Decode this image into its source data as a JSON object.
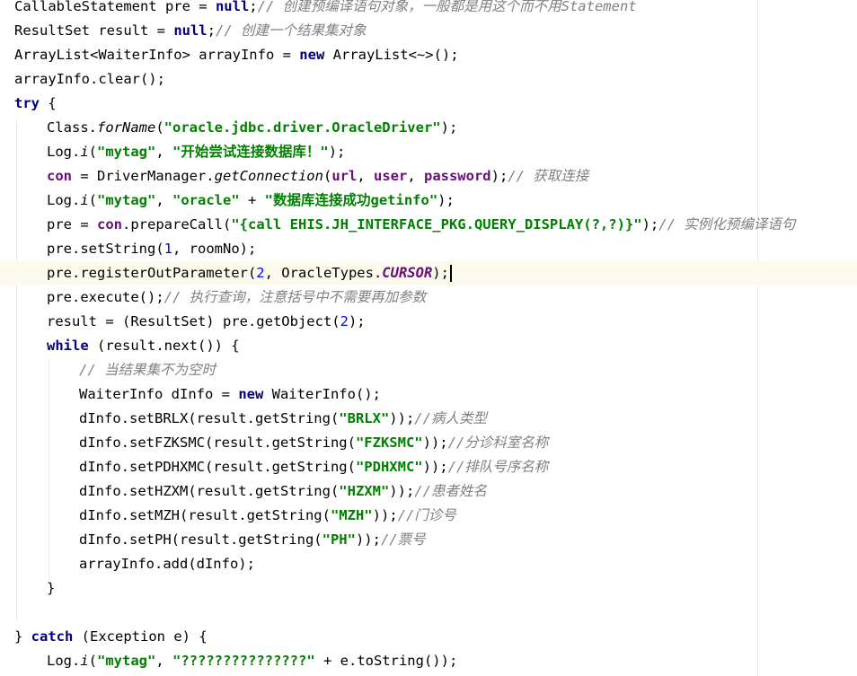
{
  "editor": {
    "caret_line": 11,
    "colors": {
      "keyword": "#000080",
      "string": "#008000",
      "comment": "#808080",
      "field": "#660e7a",
      "number": "#0000ff",
      "current_line": "#fcfaed"
    },
    "lines": [
      {
        "indent": 0,
        "tokens": [
          [
            "p",
            "CallableStatement pre = "
          ],
          [
            "k",
            "null"
          ],
          [
            "p",
            ";"
          ],
          [
            "c",
            "// 创建预编译语句对象，一般都是用这个而不用Statement"
          ]
        ]
      },
      {
        "indent": 0,
        "tokens": [
          [
            "p",
            "ResultSet result = "
          ],
          [
            "k",
            "null"
          ],
          [
            "p",
            ";"
          ],
          [
            "c",
            "// 创建一个结果集对象"
          ]
        ]
      },
      {
        "indent": 0,
        "tokens": [
          [
            "p",
            "ArrayList<WaiterInfo> arrayInfo = "
          ],
          [
            "k",
            "new"
          ],
          [
            "p",
            " ArrayList<~>();"
          ]
        ]
      },
      {
        "indent": 0,
        "tokens": [
          [
            "p",
            "arrayInfo.clear();"
          ]
        ]
      },
      {
        "indent": 0,
        "tokens": [
          [
            "k",
            "try"
          ],
          [
            "p",
            " {"
          ]
        ]
      },
      {
        "indent": 1,
        "tokens": [
          [
            "p",
            "Class."
          ],
          [
            "i",
            "forName"
          ],
          [
            "p",
            "("
          ],
          [
            "s",
            "\"oracle.jdbc.driver.OracleDriver\""
          ],
          [
            "p",
            ");"
          ]
        ]
      },
      {
        "indent": 1,
        "tokens": [
          [
            "p",
            "Log."
          ],
          [
            "i",
            "i"
          ],
          [
            "p",
            "("
          ],
          [
            "s",
            "\"mytag\""
          ],
          [
            "p",
            ", "
          ],
          [
            "s",
            "\"开始尝试连接数据库！\""
          ],
          [
            "p",
            ");"
          ]
        ]
      },
      {
        "indent": 1,
        "tokens": [
          [
            "f",
            "con"
          ],
          [
            "p",
            " = DriverManager."
          ],
          [
            "i",
            "getConnection"
          ],
          [
            "p",
            "("
          ],
          [
            "f",
            "url"
          ],
          [
            "p",
            ", "
          ],
          [
            "f",
            "user"
          ],
          [
            "p",
            ", "
          ],
          [
            "f",
            "password"
          ],
          [
            "p",
            ");"
          ],
          [
            "c",
            "// 获取连接"
          ]
        ]
      },
      {
        "indent": 1,
        "tokens": [
          [
            "p",
            "Log."
          ],
          [
            "i",
            "i"
          ],
          [
            "p",
            "("
          ],
          [
            "s",
            "\"mytag\""
          ],
          [
            "p",
            ", "
          ],
          [
            "s",
            "\"oracle\""
          ],
          [
            "p",
            " + "
          ],
          [
            "s",
            "\"数据库连接成功getinfo\""
          ],
          [
            "p",
            ");"
          ]
        ]
      },
      {
        "indent": 1,
        "tokens": [
          [
            "p",
            "pre = "
          ],
          [
            "f",
            "con"
          ],
          [
            "p",
            ".prepareCall("
          ],
          [
            "s",
            "\"{call EHIS.JH_INTERFACE_PKG.QUERY_DISPLAY(?,?)}\""
          ],
          [
            "p",
            ");"
          ],
          [
            "c",
            "// 实例化预编译语句"
          ]
        ]
      },
      {
        "indent": 1,
        "tokens": [
          [
            "p",
            "pre.setString("
          ],
          [
            "n",
            "1"
          ],
          [
            "p",
            ", roomNo);"
          ]
        ]
      },
      {
        "indent": 1,
        "tokens": [
          [
            "p",
            "pre.registerOutParameter("
          ],
          [
            "n",
            "2"
          ],
          [
            "p",
            ", OracleTypes."
          ],
          [
            "x",
            "CURSOR"
          ],
          [
            "p",
            ");"
          ]
        ]
      },
      {
        "indent": 1,
        "tokens": [
          [
            "p",
            "pre.execute();"
          ],
          [
            "c",
            "// 执行查询，注意括号中不需要再加参数"
          ]
        ]
      },
      {
        "indent": 1,
        "tokens": [
          [
            "p",
            "result = (ResultSet) pre.getObject("
          ],
          [
            "n",
            "2"
          ],
          [
            "p",
            ");"
          ]
        ]
      },
      {
        "indent": 1,
        "tokens": [
          [
            "k",
            "while"
          ],
          [
            "p",
            " (result.next()) {"
          ]
        ]
      },
      {
        "indent": 2,
        "tokens": [
          [
            "c",
            "// 当结果集不为空时"
          ]
        ]
      },
      {
        "indent": 2,
        "tokens": [
          [
            "p",
            "WaiterInfo dInfo = "
          ],
          [
            "k",
            "new"
          ],
          [
            "p",
            " WaiterInfo();"
          ]
        ]
      },
      {
        "indent": 2,
        "tokens": [
          [
            "p",
            "dInfo.setBRLX(result.getString("
          ],
          [
            "s",
            "\"BRLX\""
          ],
          [
            "p",
            "));"
          ],
          [
            "c",
            "//病人类型"
          ]
        ]
      },
      {
        "indent": 2,
        "tokens": [
          [
            "p",
            "dInfo.setFZKSMC(result.getString("
          ],
          [
            "s",
            "\"FZKSMC\""
          ],
          [
            "p",
            "));"
          ],
          [
            "c",
            "//分诊科室名称"
          ]
        ]
      },
      {
        "indent": 2,
        "tokens": [
          [
            "p",
            "dInfo.setPDHXMC(result.getString("
          ],
          [
            "s",
            "\"PDHXMC\""
          ],
          [
            "p",
            "));"
          ],
          [
            "c",
            "//排队号序名称"
          ]
        ]
      },
      {
        "indent": 2,
        "tokens": [
          [
            "p",
            "dInfo.setHZXM(result.getString("
          ],
          [
            "s",
            "\"HZXM\""
          ],
          [
            "p",
            "));"
          ],
          [
            "c",
            "//患者姓名"
          ]
        ]
      },
      {
        "indent": 2,
        "tokens": [
          [
            "p",
            "dInfo.setMZH(result.getString("
          ],
          [
            "s",
            "\"MZH\""
          ],
          [
            "p",
            "));"
          ],
          [
            "c",
            "//门诊号"
          ]
        ]
      },
      {
        "indent": 2,
        "tokens": [
          [
            "p",
            "dInfo.setPH(result.getString("
          ],
          [
            "s",
            "\"PH\""
          ],
          [
            "p",
            "));"
          ],
          [
            "c",
            "//票号"
          ]
        ]
      },
      {
        "indent": 2,
        "tokens": [
          [
            "p",
            "arrayInfo.add(dInfo);"
          ]
        ]
      },
      {
        "indent": 1,
        "tokens": [
          [
            "p",
            "}"
          ]
        ]
      },
      {
        "indent": 0,
        "tokens": []
      },
      {
        "indent": 0,
        "tokens": [
          [
            "p",
            "} "
          ],
          [
            "k",
            "catch"
          ],
          [
            "p",
            " (Exception e) {"
          ]
        ]
      },
      {
        "indent": 1,
        "tokens": [
          [
            "p",
            "Log."
          ],
          [
            "i",
            "i"
          ],
          [
            "p",
            "("
          ],
          [
            "s",
            "\"mytag\""
          ],
          [
            "p",
            ", "
          ],
          [
            "s",
            "\"???????????????\""
          ],
          [
            "p",
            " + e.toString());"
          ]
        ]
      }
    ]
  }
}
